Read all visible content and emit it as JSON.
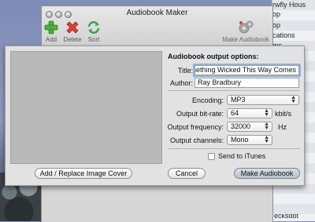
{
  "window": {
    "title": "Audiobook Maker",
    "toolbar": {
      "add_label": "Add",
      "delete_label": "Delete",
      "sort_label": "Sort",
      "make_label": "Make Audiobook"
    }
  },
  "background_list": {
    "items": [
      "rwfly Hous",
      "op",
      "op",
      "cations",
      "ms",
      "ies",
      "eo",
      "ds",
      "",
      "",
      "",
      "",
      "",
      "",
      "",
      "ecksdot"
    ]
  },
  "dialog": {
    "heading": "Audiobook output options:",
    "title_label": "Title:",
    "title_value": "Something Wicked This Way Comes",
    "author_label": "Author:",
    "author_value": "Ray Bradbury",
    "encoding_label": "Encoding:",
    "encoding_value": "MP3",
    "bitrate_label": "Output bit-rate:",
    "bitrate_value": "64",
    "bitrate_unit": "kbit/s",
    "frequency_label": "Output frequency:",
    "frequency_value": "32000",
    "frequency_unit": "Hz",
    "channels_label": "Output channels:",
    "channels_value": "Mono",
    "itunes_label": "Send to iTunes",
    "itunes_checked": false,
    "cover_button": "Add / Replace Image Cover",
    "cancel_button": "Cancel",
    "make_button": "Make Audiobook"
  },
  "colors": {
    "add_icon": "#4caf3a",
    "delete_icon": "#d9423a",
    "sort_icon": "#3fa34d",
    "focus_ring": "#8fb3e0"
  }
}
